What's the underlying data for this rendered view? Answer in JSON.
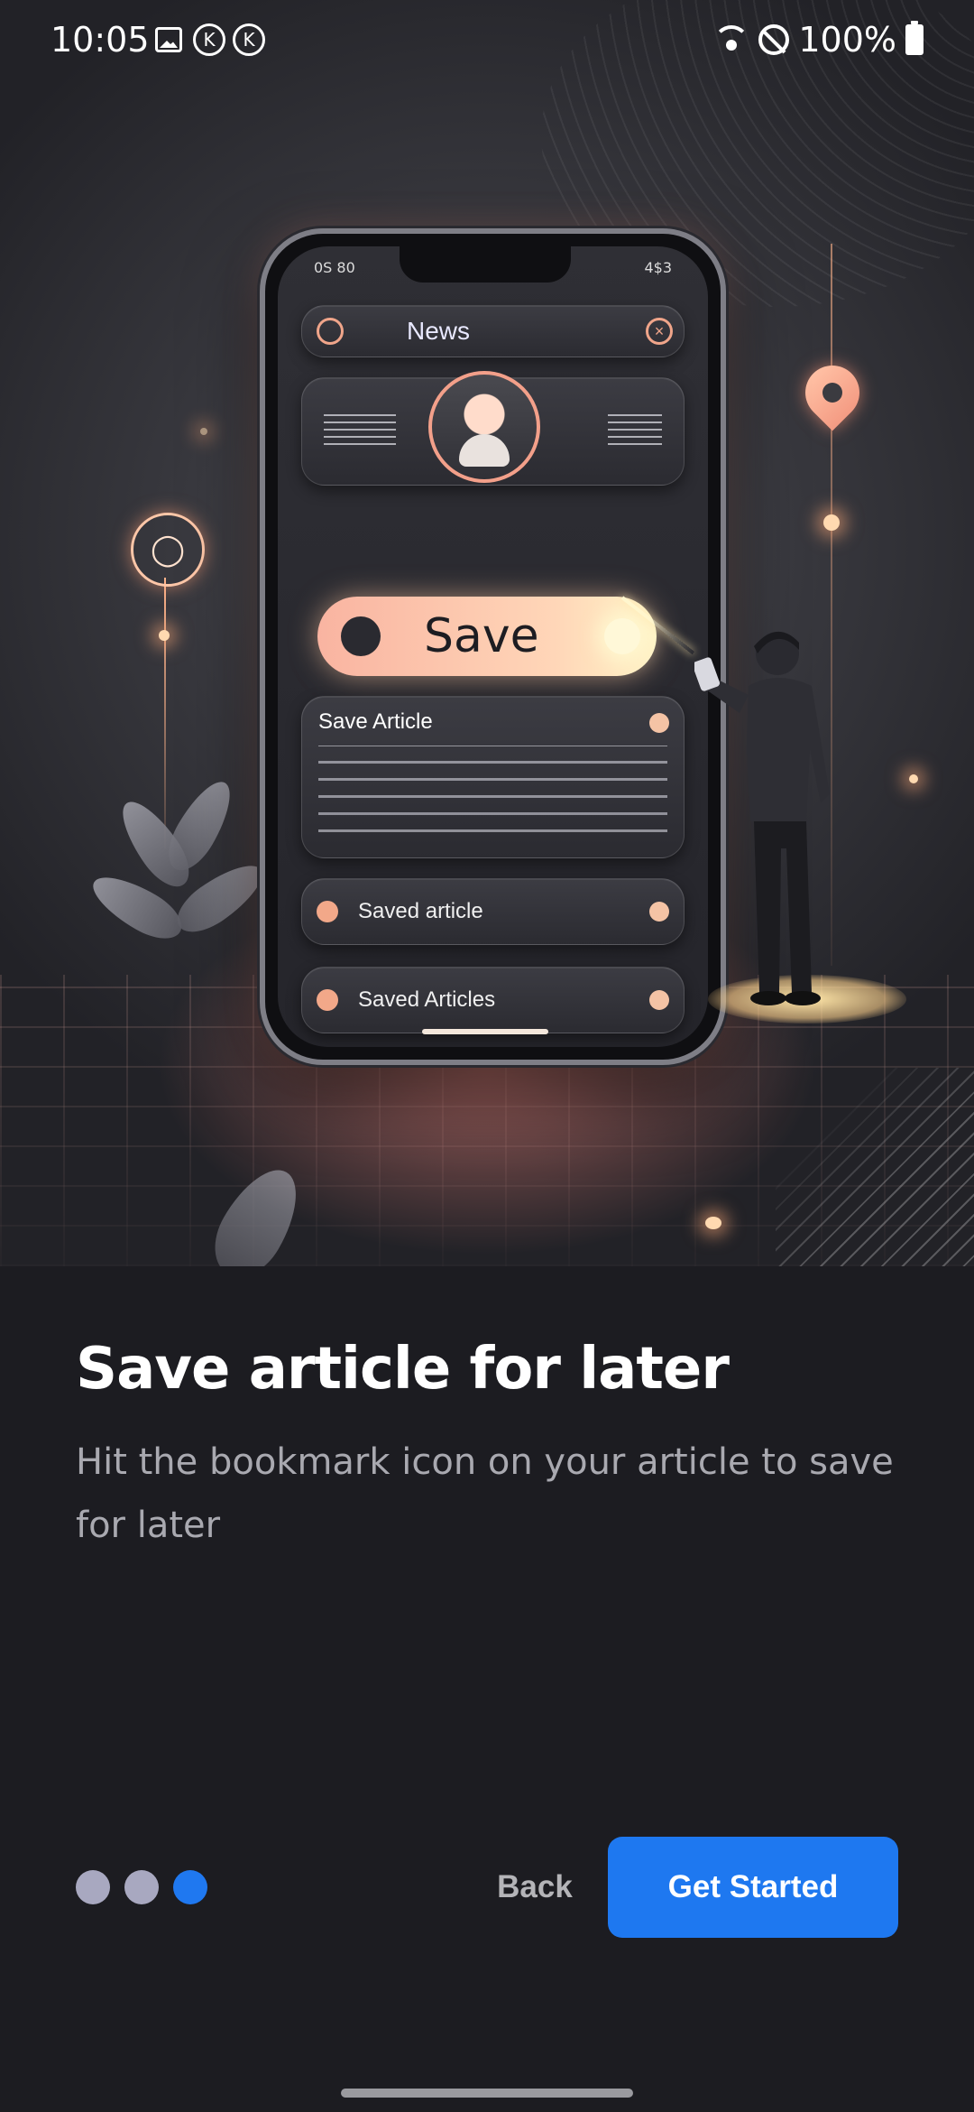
{
  "status_bar": {
    "time": "10:05",
    "notification_icons": [
      "image-icon",
      "k-circle-icon",
      "k-circle-icon"
    ],
    "notification_letter": "K",
    "battery": "100%"
  },
  "hero_illustration": {
    "phone_status_left": "0S 80",
    "phone_status_right": "4$3",
    "news_label": "News",
    "save_button_label": "Save",
    "article_card_title": "Save Article",
    "row1_label": "Saved article",
    "row2_label": "Saved Articles"
  },
  "onboarding": {
    "title": "Save article for later",
    "description": "Hit the bookmark icon on your article to save for later",
    "page_count": 3,
    "current_page": 3
  },
  "actions": {
    "back_label": "Back",
    "primary_label": "Get Started"
  },
  "colors": {
    "background": "#1c1c21",
    "accent": "#1e78f0",
    "inactive_dot": "#a8a8c0"
  }
}
